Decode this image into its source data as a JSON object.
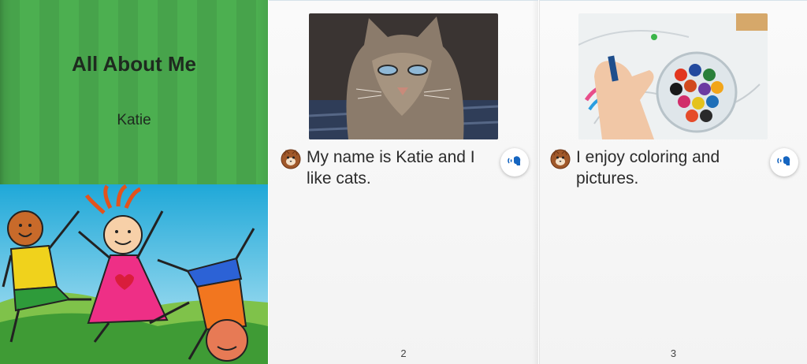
{
  "cover": {
    "title": "All About Me",
    "author": "Katie",
    "background_color": "#4caf50"
  },
  "pages": [
    {
      "photo": "tabby-cat-photo",
      "text": "My name is Katie and I like cats.",
      "page_number": "2",
      "reader_icon": "cat-avatar-icon",
      "audio_icon": "speaker-audio-icon"
    },
    {
      "photo": "crayons-coloring-photo",
      "text": "I enjoy coloring and pictures.",
      "page_number": "3",
      "reader_icon": "cat-avatar-icon",
      "audio_icon": "speaker-audio-icon"
    }
  ],
  "colors": {
    "accent_blue": "#1565c0",
    "text": "#2b2b2b"
  }
}
